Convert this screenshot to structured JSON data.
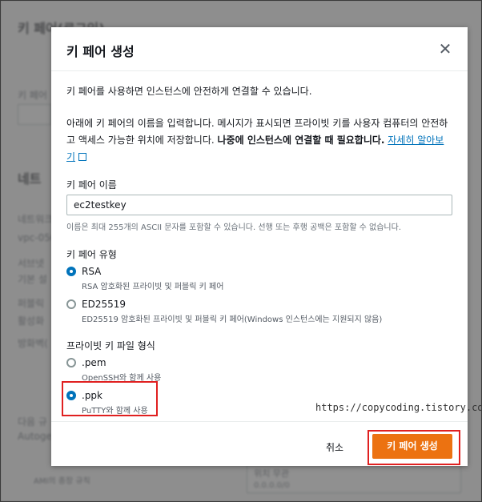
{
  "background": {
    "title1": "키 페어(로그인)",
    "title2": "네트",
    "lines": [
      "키 페어",
      "네트워크",
      "vpc-056",
      "서브넷",
      "기본 설",
      "퍼블릭",
      "활성화",
      "방화벽(",
      "다음 규",
      "Autoge",
      "AMI의 종장 규칙",
      "위치 무관",
      "0.0.0.0/0"
    ]
  },
  "modal": {
    "title": "키 페어 생성",
    "intro": "키 페어를 사용하면 인스턴스에 안전하게 연결할 수 있습니다.",
    "instructions": "아래에 키 페어의 이름을 입력합니다. 메시지가 표시되면 프라이빗 키를 사용자 컴퓨터의 안전하고 액세스 가능한 위치에 저장합니다.",
    "instructions_bold": "나중에 인스턴스에 연결할 때 필요합니다.",
    "learn_more": "자세히 알아보기",
    "name_label": "키 페어 이름",
    "name_value": "ec2testkey",
    "name_hint": "이름은 최대 255개의 ASCII 문자를 포함할 수 있습니다. 선행 또는 후행 공백은 포함할 수 없습니다.",
    "type_label": "키 페어 유형",
    "types": [
      {
        "label": "RSA",
        "desc": "RSA 암호화된 프라이빗 및 퍼블릭 키 페어",
        "selected": true
      },
      {
        "label": "ED25519",
        "desc": "ED25519 암호화된 프라이빗 및 퍼블릭 키 페어(Windows 인스턴스에는 지원되지 않음)",
        "selected": false
      }
    ],
    "format_label": "프라이빗 키 파일 형식",
    "formats": [
      {
        "label": ".pem",
        "desc": "OpenSSH와 함께 사용",
        "selected": false
      },
      {
        "label": ".ppk",
        "desc": "PuTTY와 함께 사용",
        "selected": true
      }
    ],
    "watermark": "https://copycoding.tistory.com/",
    "cancel_label": "취소",
    "create_label": "키 페어 생성"
  },
  "colors": {
    "accent": "#ec7211",
    "link": "#0073bb",
    "highlight": "#e02020"
  }
}
